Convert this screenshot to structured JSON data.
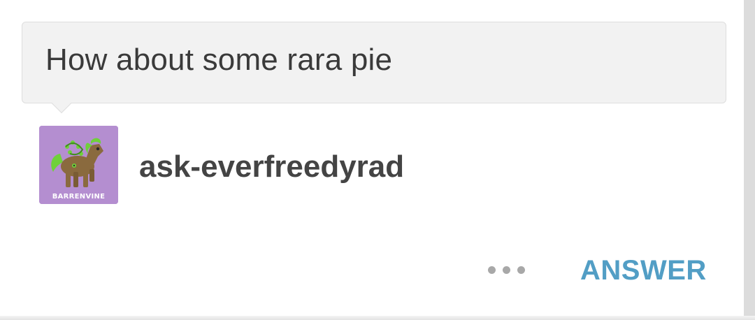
{
  "question": {
    "text": "How about some rara pie"
  },
  "asker": {
    "username": "ask-everfreedyrad",
    "avatar_caption": "BARRENVINE",
    "avatar_bg_color": "#b48ed0"
  },
  "actions": {
    "more_icon": "more-horizontal-dots",
    "answer_label": "ANSWER",
    "answer_color": "#529ec5"
  }
}
